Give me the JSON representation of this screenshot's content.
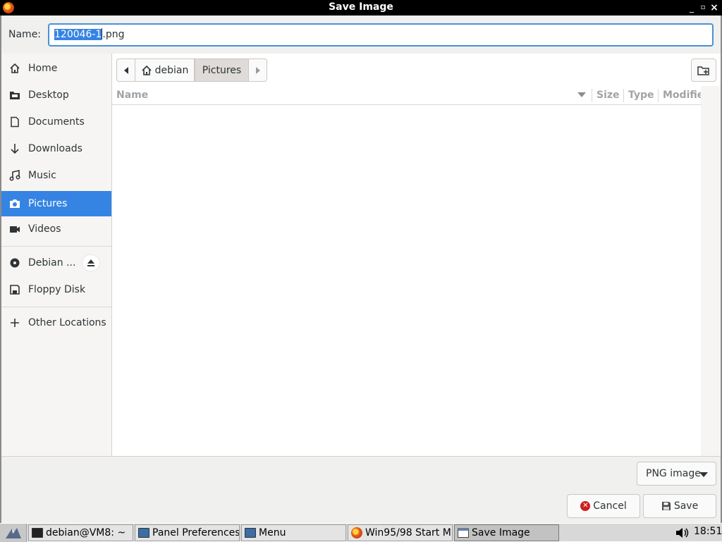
{
  "window": {
    "title": "Save Image",
    "minimize_glyph": "_",
    "maximize_glyph": "▫",
    "close_glyph": "×"
  },
  "name_row": {
    "label": "Name:",
    "value_selected": "120046-1",
    "value_rest": ".png",
    "value": "120046-1.png"
  },
  "sidebar": {
    "items": [
      {
        "label": "Home",
        "icon": "home-icon"
      },
      {
        "label": "Desktop",
        "icon": "desktop-folder-icon"
      },
      {
        "label": "Documents",
        "icon": "document-icon"
      },
      {
        "label": "Downloads",
        "icon": "download-arrow-icon"
      },
      {
        "label": "Music",
        "icon": "music-icon"
      },
      {
        "label": "Pictures",
        "icon": "camera-icon",
        "active": true
      },
      {
        "label": "Videos",
        "icon": "video-icon"
      }
    ],
    "devices": [
      {
        "label": "Debian ...",
        "icon": "disc-icon",
        "eject": "eject-icon"
      },
      {
        "label": "Floppy Disk",
        "icon": "floppy-icon"
      }
    ],
    "other": {
      "label": "Other Locations",
      "icon": "plus-icon"
    }
  },
  "pathbar": {
    "crumbs": [
      "debian",
      "Pictures"
    ]
  },
  "filelist": {
    "columns": [
      "Name",
      "Size",
      "Type",
      "Modifie"
    ],
    "rows": []
  },
  "footer": {
    "filter_label": "PNG image",
    "cancel_label": "Cancel",
    "save_label": "Save"
  },
  "taskbar": {
    "tasks": [
      {
        "label": "debian@VM8: ~",
        "icon": "terminal-icon"
      },
      {
        "label": "Panel Preferences",
        "icon": "monitor-icon"
      },
      {
        "label": "Menu",
        "icon": "monitor-icon"
      },
      {
        "label": "Win95/98 Start M...",
        "icon": "firefox-icon"
      },
      {
        "label": "Save Image",
        "icon": "window-icon",
        "active": true
      }
    ],
    "clock": "18:51",
    "volume_glyph": "🔊"
  },
  "colors": {
    "accent": "#3584e4",
    "focus": "#4a90d9",
    "titlebar": "#000000"
  }
}
